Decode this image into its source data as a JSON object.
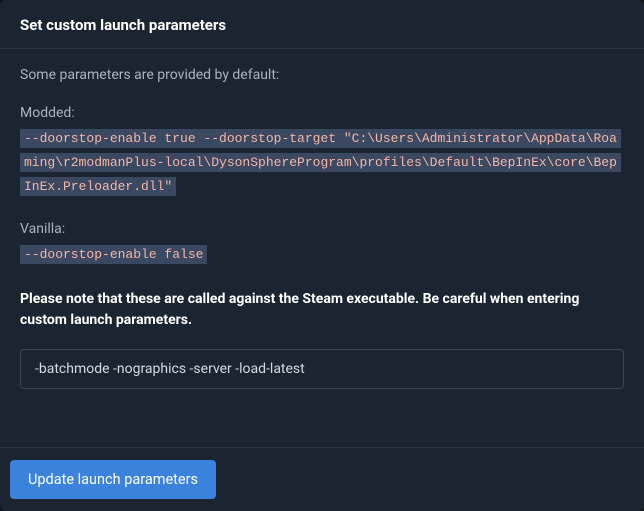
{
  "header": {
    "title": "Set custom launch parameters"
  },
  "body": {
    "intro": "Some parameters are provided by default:",
    "modded": {
      "label": "Modded:",
      "value": "--doorstop-enable true --doorstop-target \"C:\\Users\\Administrator\\AppData\\Roaming\\r2modmanPlus-local\\DysonSphereProgram\\profiles\\Default\\BepInEx\\core\\BepInEx.Preloader.dll\""
    },
    "vanilla": {
      "label": "Vanilla:",
      "value": "--doorstop-enable false"
    },
    "note": "Please note that these are called against the Steam executable. Be careful when entering custom launch parameters.",
    "input": {
      "value": "-batchmode -nographics -server -load-latest",
      "placeholder": ""
    }
  },
  "footer": {
    "update_label": "Update launch parameters"
  }
}
